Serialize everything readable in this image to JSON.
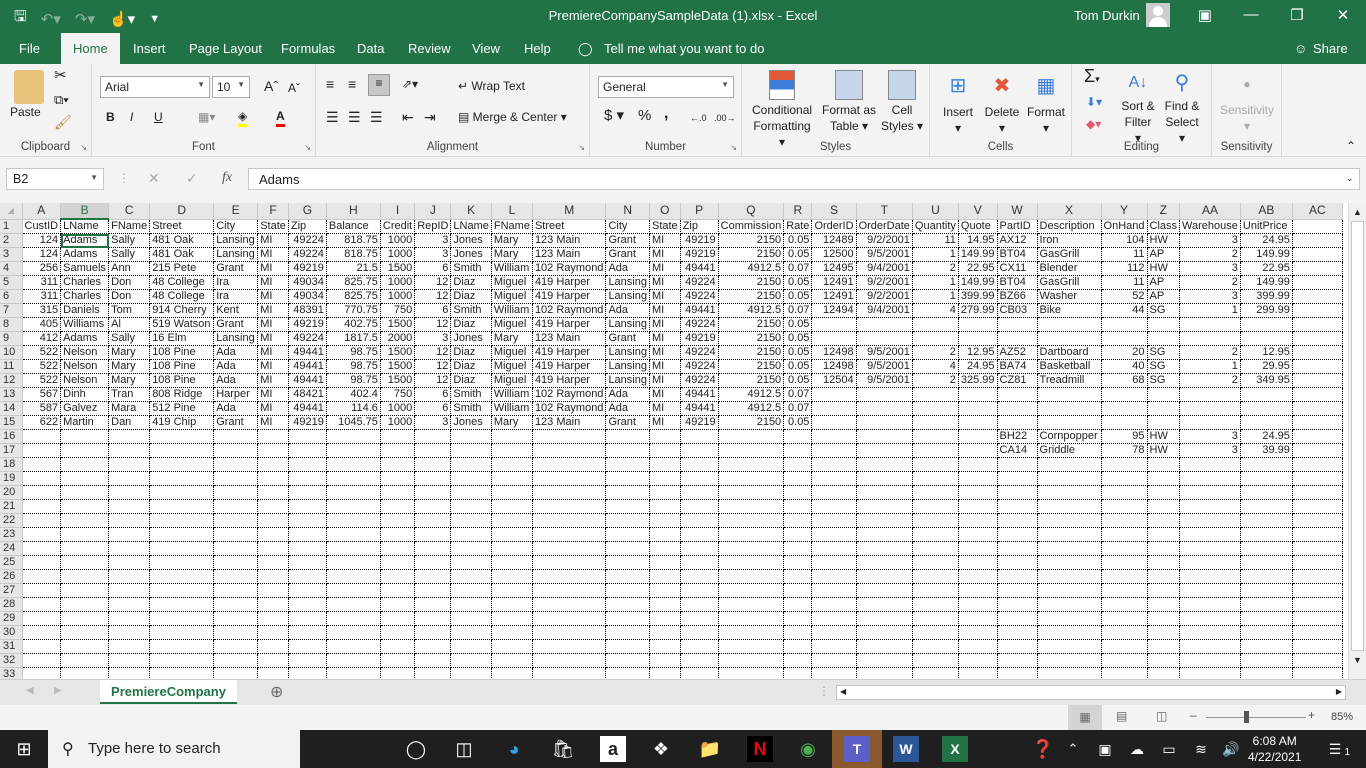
{
  "window": {
    "title": "PremiereCompanySampleData (1).xlsx  -  Excel",
    "user": "Tom Durkin"
  },
  "qat": {
    "save_icon": "save-icon",
    "undo_icon": "undo-icon",
    "redo_icon": "redo-icon",
    "touch_icon": "touch-mode-icon",
    "customize_icon": "customize-icon"
  },
  "menu": {
    "tabs": [
      "File",
      "Home",
      "Insert",
      "Page Layout",
      "Formulas",
      "Data",
      "Review",
      "View",
      "Help"
    ],
    "active": "Home",
    "tell_me": "Tell me what you want to do",
    "share": "Share"
  },
  "ribbon": {
    "clipboard": {
      "label": "Clipboard",
      "paste": "Paste"
    },
    "font": {
      "label": "Font",
      "name": "Arial",
      "size": "10",
      "bold": "B",
      "italic": "I",
      "underline": "U"
    },
    "alignment": {
      "label": "Alignment",
      "wrap": "Wrap Text",
      "merge": "Merge & Center"
    },
    "number": {
      "label": "Number",
      "format": "General",
      "currency": "$",
      "percent": "%",
      "comma": ","
    },
    "styles": {
      "label": "Styles",
      "conditional": "Conditional",
      "conditional2": "Formatting",
      "format_table": "Format as",
      "format_table2": "Table",
      "cell_styles": "Cell",
      "cell_styles2": "Styles"
    },
    "cells": {
      "label": "Cells",
      "insert": "Insert",
      "delete": "Delete",
      "format": "Format"
    },
    "editing": {
      "label": "Editing",
      "sort": "Sort &",
      "sort2": "Filter",
      "find": "Find &",
      "find2": "Select"
    },
    "sensitivity": {
      "label": "Sensitivity",
      "button": "Sensitivity"
    }
  },
  "formula_bar": {
    "name_box": "B2",
    "fx": "fx",
    "value": "Adams"
  },
  "grid": {
    "columns": [
      "A",
      "B",
      "C",
      "D",
      "E",
      "F",
      "G",
      "H",
      "I",
      "J",
      "K",
      "L",
      "M",
      "N",
      "O",
      "P",
      "Q",
      "R",
      "S",
      "T",
      "U",
      "V",
      "W",
      "X",
      "Y",
      "Z",
      "AA",
      "AB",
      "AC"
    ],
    "selected_column": "B",
    "selected_cell": "B2",
    "row_count": 33,
    "rows": [
      [
        "CustID",
        "LName",
        "FName",
        "Street",
        "City",
        "State",
        "Zip",
        "Balance",
        "Credit",
        "RepID",
        "LName",
        "FName",
        "Street",
        "City",
        "State",
        "Zip",
        "Commission",
        "Rate",
        "OrderID",
        "OrderDate",
        "Quantity",
        "Quote",
        "PartID",
        "Description",
        "OnHand",
        "Class",
        "Warehouse",
        "UnitPrice",
        ""
      ],
      [
        "124",
        "Adams",
        "Sally",
        "481 Oak",
        "Lansing",
        "MI",
        "49224",
        "818.75",
        "1000",
        "3",
        "Jones",
        "Mary",
        "123 Main",
        "Grant",
        "MI",
        "49219",
        "2150",
        "0.05",
        "12489",
        "9/2/2001",
        "11",
        "14.95",
        "AX12",
        "Iron",
        "104",
        "HW",
        "3",
        "24.95",
        ""
      ],
      [
        "124",
        "Adams",
        "Sally",
        "481 Oak",
        "Lansing",
        "MI",
        "49224",
        "818.75",
        "1000",
        "3",
        "Jones",
        "Mary",
        "123 Main",
        "Grant",
        "MI",
        "49219",
        "2150",
        "0.05",
        "12500",
        "9/5/2001",
        "1",
        "149.99",
        "BT04",
        "GasGrill",
        "11",
        "AP",
        "2",
        "149.99",
        ""
      ],
      [
        "256",
        "Samuels",
        "Ann",
        "215 Pete",
        "Grant",
        "MI",
        "49219",
        "21.5",
        "1500",
        "6",
        "Smith",
        "William",
        "102 Raymond",
        "Ada",
        "MI",
        "49441",
        "4912.5",
        "0.07",
        "12495",
        "9/4/2001",
        "2",
        "22.95",
        "CX11",
        "Blender",
        "112",
        "HW",
        "3",
        "22.95",
        ""
      ],
      [
        "311",
        "Charles",
        "Don",
        "48 College",
        "Ira",
        "MI",
        "49034",
        "825.75",
        "1000",
        "12",
        "Diaz",
        "Miguel",
        "419 Harper",
        "Lansing",
        "MI",
        "49224",
        "2150",
        "0.05",
        "12491",
        "9/2/2001",
        "1",
        "149.99",
        "BT04",
        "GasGrill",
        "11",
        "AP",
        "2",
        "149.99",
        ""
      ],
      [
        "311",
        "Charles",
        "Don",
        "48 College",
        "Ira",
        "MI",
        "49034",
        "825.75",
        "1000",
        "12",
        "Diaz",
        "Miguel",
        "419 Harper",
        "Lansing",
        "MI",
        "49224",
        "2150",
        "0.05",
        "12491",
        "9/2/2001",
        "1",
        "399.99",
        "BZ66",
        "Washer",
        "52",
        "AP",
        "3",
        "399.99",
        ""
      ],
      [
        "315",
        "Daniels",
        "Tom",
        "914 Cherry",
        "Kent",
        "MI",
        "48391",
        "770.75",
        "750",
        "6",
        "Smith",
        "William",
        "102 Raymond",
        "Ada",
        "MI",
        "49441",
        "4912.5",
        "0.07",
        "12494",
        "9/4/2001",
        "4",
        "279.99",
        "CB03",
        "Bike",
        "44",
        "SG",
        "1",
        "299.99",
        ""
      ],
      [
        "405",
        "Williams",
        "Al",
        "519 Watson",
        "Grant",
        "MI",
        "49219",
        "402.75",
        "1500",
        "12",
        "Diaz",
        "Miguel",
        "419 Harper",
        "Lansing",
        "MI",
        "49224",
        "2150",
        "0.05",
        "",
        "",
        "",
        "",
        "",
        "",
        "",
        "",
        "",
        "",
        ""
      ],
      [
        "412",
        "Adams",
        "Sally",
        "16 Elm",
        "Lansing",
        "MI",
        "49224",
        "1817.5",
        "2000",
        "3",
        "Jones",
        "Mary",
        "123 Main",
        "Grant",
        "MI",
        "49219",
        "2150",
        "0.05",
        "",
        "",
        "",
        "",
        "",
        "",
        "",
        "",
        "",
        "",
        ""
      ],
      [
        "522",
        "Nelson",
        "Mary",
        "108 Pine",
        "Ada",
        "MI",
        "49441",
        "98.75",
        "1500",
        "12",
        "Diaz",
        "Miguel",
        "419 Harper",
        "Lansing",
        "MI",
        "49224",
        "2150",
        "0.05",
        "12498",
        "9/5/2001",
        "2",
        "12.95",
        "AZ52",
        "Dartboard",
        "20",
        "SG",
        "2",
        "12.95",
        ""
      ],
      [
        "522",
        "Nelson",
        "Mary",
        "108 Pine",
        "Ada",
        "MI",
        "49441",
        "98.75",
        "1500",
        "12",
        "Diaz",
        "Miguel",
        "419 Harper",
        "Lansing",
        "MI",
        "49224",
        "2150",
        "0.05",
        "12498",
        "9/5/2001",
        "4",
        "24.95",
        "BA74",
        "Basketball",
        "40",
        "SG",
        "1",
        "29.95",
        ""
      ],
      [
        "522",
        "Nelson",
        "Mary",
        "108 Pine",
        "Ada",
        "MI",
        "49441",
        "98.75",
        "1500",
        "12",
        "Diaz",
        "Miguel",
        "419 Harper",
        "Lansing",
        "MI",
        "49224",
        "2150",
        "0.05",
        "12504",
        "9/5/2001",
        "2",
        "325.99",
        "CZ81",
        "Treadmill",
        "68",
        "SG",
        "2",
        "349.95",
        ""
      ],
      [
        "567",
        "Dinh",
        "Tran",
        "808 Ridge",
        "Harper",
        "MI",
        "48421",
        "402.4",
        "750",
        "6",
        "Smith",
        "William",
        "102 Raymond",
        "Ada",
        "MI",
        "49441",
        "4912.5",
        "0.07",
        "",
        "",
        "",
        "",
        "",
        "",
        "",
        "",
        "",
        "",
        ""
      ],
      [
        "587",
        "Galvez",
        "Mara",
        "512 Pine",
        "Ada",
        "MI",
        "49441",
        "114.6",
        "1000",
        "6",
        "Smith",
        "William",
        "102 Raymond",
        "Ada",
        "MI",
        "49441",
        "4912.5",
        "0.07",
        "",
        "",
        "",
        "",
        "",
        "",
        "",
        "",
        "",
        "",
        ""
      ],
      [
        "622",
        "Martin",
        "Dan",
        "419 Chip",
        "Grant",
        "MI",
        "49219",
        "1045.75",
        "1000",
        "3",
        "Jones",
        "Mary",
        "123 Main",
        "Grant",
        "MI",
        "49219",
        "2150",
        "0.05",
        "",
        "",
        "",
        "",
        "",
        "",
        "",
        "",
        "",
        "",
        ""
      ],
      [
        "",
        "",
        "",
        "",
        "",
        "",
        "",
        "",
        "",
        "",
        "",
        "",
        "",
        "",
        "",
        "",
        "",
        "",
        "",
        "",
        "",
        "",
        "BH22",
        "Cornpopper",
        "95",
        "HW",
        "3",
        "24.95",
        ""
      ],
      [
        "",
        "",
        "",
        "",
        "",
        "",
        "",
        "",
        "",
        "",
        "",
        "",
        "",
        "",
        "",
        "",
        "",
        "",
        "",
        "",
        "",
        "",
        "CA14",
        "Griddle",
        "78",
        "HW",
        "3",
        "39.99",
        ""
      ]
    ]
  },
  "sheets": {
    "active": "PremiereCompany"
  },
  "status": {
    "zoom": "85%",
    "zoom_level_percent": 85
  },
  "taskbar": {
    "search_placeholder": "Type here to search",
    "time": "6:08 AM",
    "date": "4/22/2021",
    "notifications": "1",
    "apps": [
      "cortana",
      "task-view",
      "edge",
      "store",
      "amazon",
      "dropbox",
      "file-explorer",
      "netflix",
      "chrome",
      "teams",
      "word",
      "excel"
    ]
  }
}
